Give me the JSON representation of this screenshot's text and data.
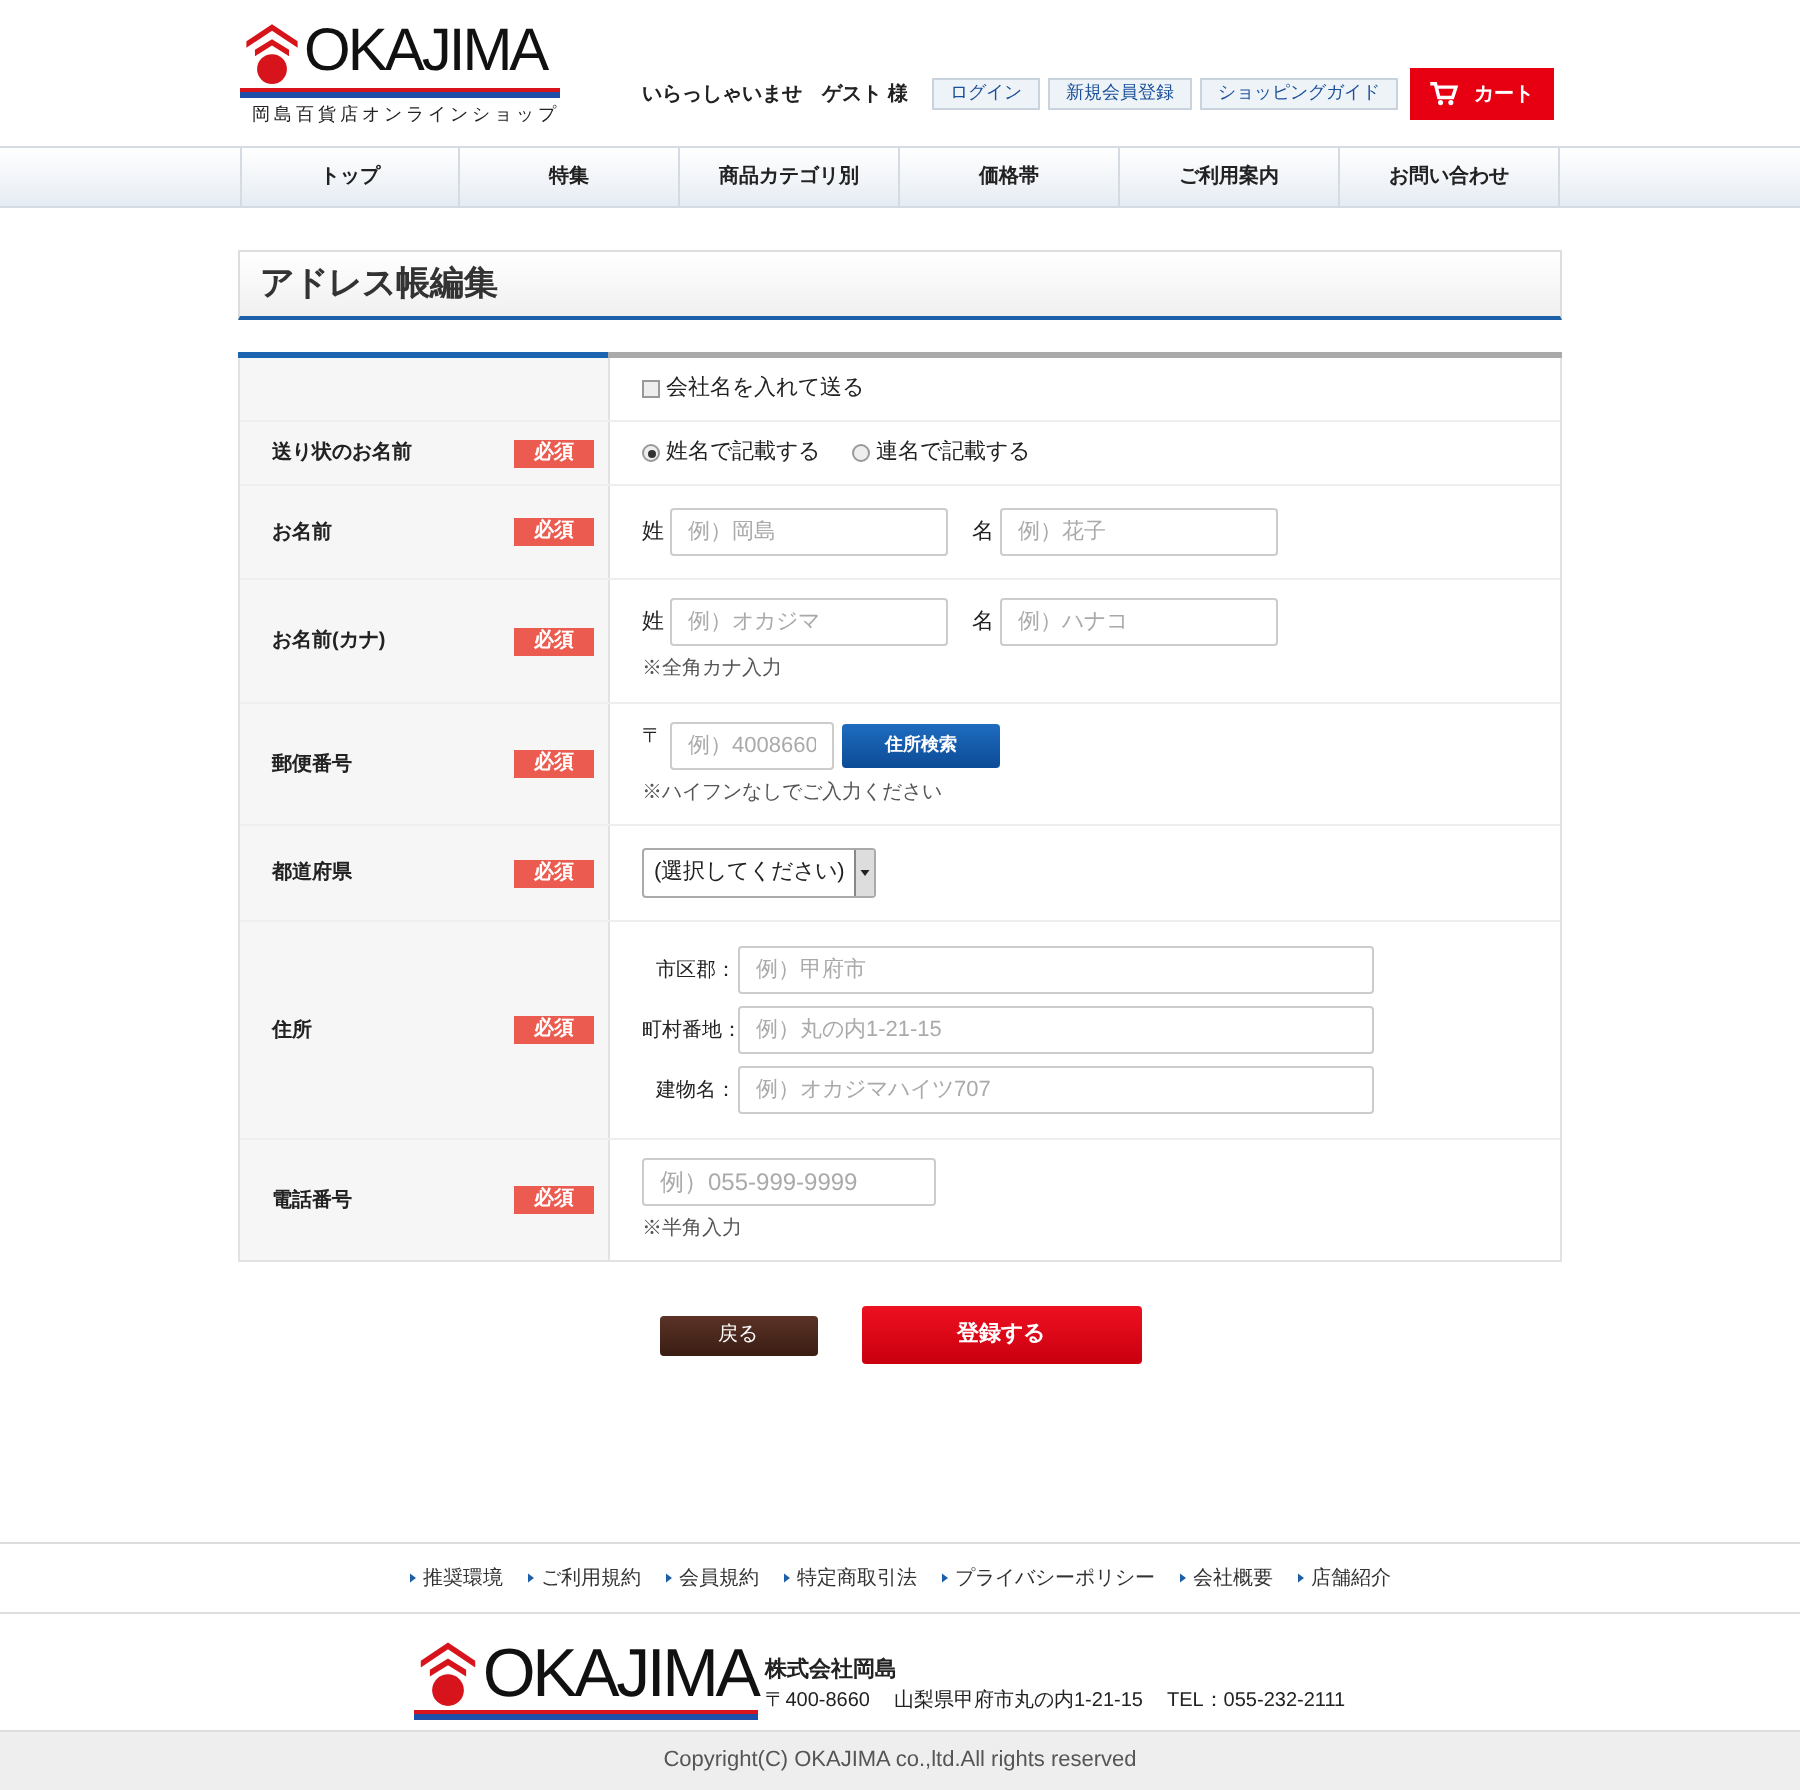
{
  "header": {
    "logo": {
      "name": "OKAJIMA",
      "tagline": "岡島百貨店オンラインショップ"
    },
    "greeting": "いらっしゃいませ",
    "user": "ゲスト 様",
    "buttons": [
      "ログイン",
      "新規会員登録",
      "ショッピングガイド"
    ],
    "cart": "カート"
  },
  "nav": {
    "items": [
      {
        "label": "トップ"
      },
      {
        "label": "特集"
      },
      {
        "label": "商品カテゴリ別"
      },
      {
        "label": "価格帯"
      },
      {
        "label": "ご利用案内"
      },
      {
        "label": "お問い合わせ"
      }
    ]
  },
  "page_title": "アドレス帳編集",
  "form": {
    "rows": [
      {
        "kind": "checkbox",
        "option": {
          "label": "会社名を入れて送る",
          "checked": false
        }
      },
      {
        "kind": "radio",
        "label": "送り状のお名前",
        "badge": "必須",
        "options": [
          {
            "label": "姓名で記載する",
            "selected": true
          },
          {
            "label": "連名で記載する",
            "selected": false
          }
        ]
      },
      {
        "kind": "inline",
        "label": "お名前",
        "badge": "必須",
        "fields": [
          {
            "label": "姓",
            "placeholder": "例）岡島"
          },
          {
            "label": "名",
            "placeholder": "例）花子"
          }
        ]
      },
      {
        "kind": "inline",
        "label": "お名前(カナ)",
        "badge": "必須",
        "fields": [
          {
            "label": "姓",
            "placeholder": "例）オカジマ"
          },
          {
            "label": "名",
            "placeholder": "例）ハナコ"
          }
        ],
        "note": "※全角カナ入力"
      },
      {
        "kind": "zip",
        "label": "郵便番号",
        "badge": "必須",
        "prefix": "〒",
        "placeholder": "例）4008660",
        "button": "住所検索",
        "note": "※ハイフンなしでご入力ください"
      },
      {
        "kind": "select",
        "label": "都道府県",
        "badge": "必須",
        "value": "(選択してください)"
      },
      {
        "kind": "stacked",
        "label": "住所",
        "badge": "必須",
        "fields": [
          {
            "label": "市区郡：",
            "placeholder": "例）甲府市"
          },
          {
            "label": "町村番地：",
            "placeholder": "例）丸の内1-21-15"
          },
          {
            "label": "建物名：",
            "placeholder": "例）オカジマハイツ707"
          }
        ]
      },
      {
        "kind": "inline",
        "label": "電話番号",
        "badge": "必須",
        "fields": [
          {
            "placeholder": "例）055-999-9999"
          }
        ],
        "note": "※半角入力"
      }
    ]
  },
  "actions": {
    "back": "戻る",
    "submit": "登録する"
  },
  "footer": {
    "links": [
      "推奨環境",
      "ご利用規約",
      "会員規約",
      "特定商取引法",
      "プライバシーポリシー",
      "会社概要",
      "店舗紹介"
    ],
    "logo": {
      "name": "OKAJIMA"
    },
    "company": "株式会社岡島",
    "postal": "〒400-8660",
    "address": "山梨県甲府市丸の内1-21-15",
    "tel": "TEL：055-232-2111",
    "copyright": "Copyright(C) OKAJIMA co.,ltd.All rights reserved"
  }
}
